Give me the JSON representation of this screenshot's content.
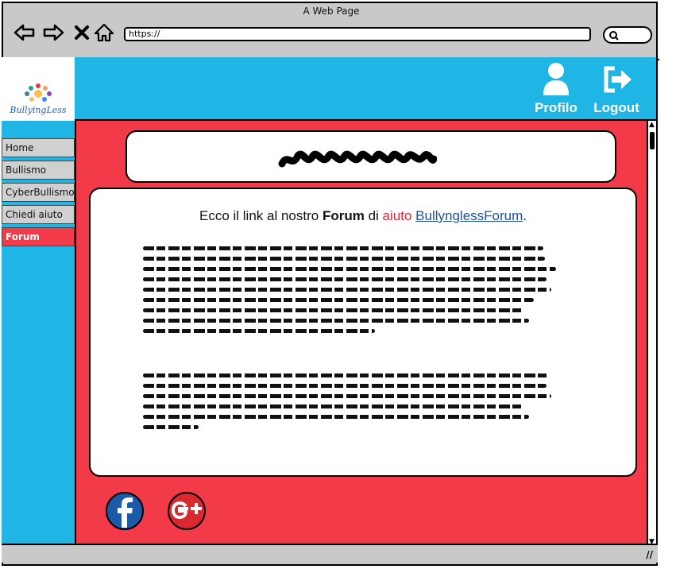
{
  "window": {
    "title": "A Web Page",
    "url": "https://"
  },
  "logo": {
    "text": "BullyingLess"
  },
  "header": {
    "profile_label": "Profilo",
    "logout_label": "Logout"
  },
  "sidebar": {
    "items": [
      {
        "label": "Home"
      },
      {
        "label": "Bullismo"
      },
      {
        "label": "CyberBullismo"
      },
      {
        "label": "Chiedi aiuto"
      },
      {
        "label": "Forum"
      }
    ],
    "active_index": 4
  },
  "main": {
    "intro_prefix": "Ecco il link al nostro",
    "intro_bold": "Forum",
    "intro_middle": "di",
    "intro_red": "aiuto",
    "forum_link": "BullynglessForum",
    "intro_suffix": "."
  },
  "social": {
    "facebook_icon": "facebook-icon",
    "googleplus_icon": "google-plus-icon"
  },
  "colors": {
    "topbar": "#1fb6e6",
    "main_bg": "#f23a49",
    "active_item": "#f23a49",
    "link": "#1f4f9a",
    "facebook": "#1b5aa8",
    "googleplus": "#d9282f"
  }
}
